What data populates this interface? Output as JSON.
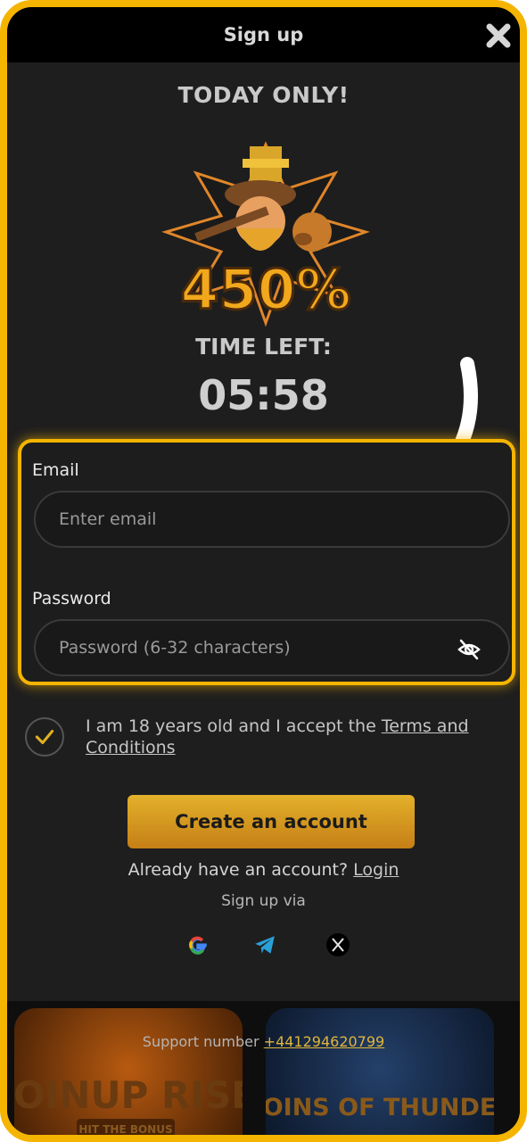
{
  "header": {
    "title": "Sign up"
  },
  "promo": {
    "headline": "TODAY ONLY!",
    "bonus_text": "450%",
    "timer_label": "TIME LEFT:",
    "timer_value": "05:58"
  },
  "form": {
    "email_label": "Email",
    "email_placeholder": "Enter email",
    "password_label": "Password",
    "password_placeholder": "Password (6-32 characters)"
  },
  "consent": {
    "text": "I am 18 years old and I accept the ",
    "link": "Terms and Conditions",
    "checked": true
  },
  "actions": {
    "create_account": "Create an account",
    "already_text": "Already have an account?",
    "login_link": "Login",
    "signup_via": "Sign up via"
  },
  "social": [
    "google-icon",
    "telegram-icon",
    "x-icon"
  ],
  "footer": {
    "support_label": "Support number",
    "support_phone": "+441294620799",
    "games": [
      "COINUP RISE",
      "HIT THE BONUS",
      "COINS OF THUNDER"
    ]
  },
  "colors": {
    "accent": "#f5b400",
    "button_top": "#e3b12a",
    "button_bottom": "#c57f16"
  }
}
